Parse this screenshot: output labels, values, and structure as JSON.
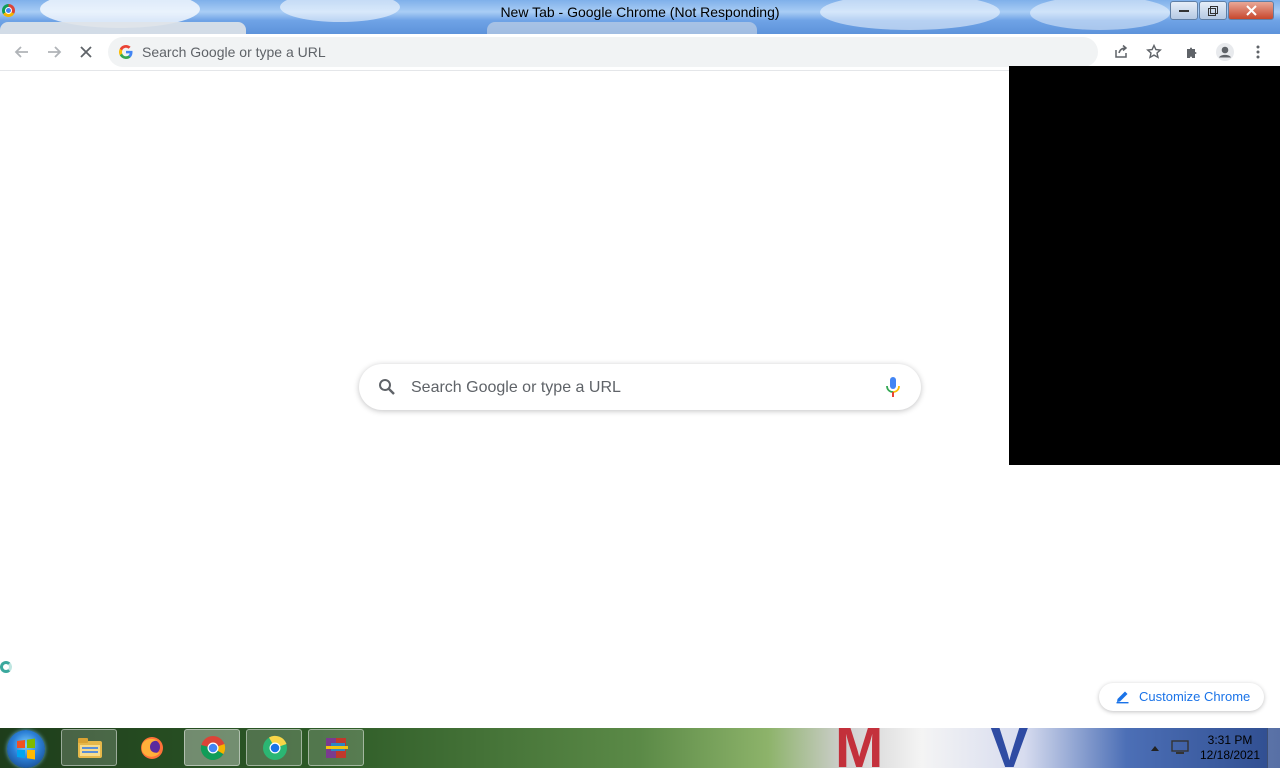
{
  "window": {
    "title": "New Tab - Google Chrome (Not Responding)",
    "controls": {
      "minimize": "minimize",
      "restore": "restore",
      "close": "close"
    }
  },
  "toolbar": {
    "back_icon": "back-arrow-icon",
    "forward_icon": "forward-arrow-icon",
    "stop_icon": "stop-x-icon",
    "omnibox_placeholder": "Search Google or type a URL",
    "right_icons": [
      "share-icon",
      "bookmark-star-icon",
      "extensions-puzzle-icon",
      "profile-icon",
      "menu-kebab-icon"
    ]
  },
  "newtab": {
    "search_placeholder": "Search Google or type a URL",
    "customize_label": "Customize Chrome"
  },
  "taskbar": {
    "pinned": [
      "windows-explorer-icon",
      "firefox-icon",
      "chrome-icon",
      "chrome-canary-icon",
      "winrar-icon"
    ],
    "active_app": "chrome-icon",
    "clock": {
      "time": "3:31 PM",
      "date": "12/18/2021"
    }
  },
  "colors": {
    "accent": "#1a73e8",
    "omnibox_bg": "#f1f3f4",
    "text_muted": "#5f6368"
  }
}
